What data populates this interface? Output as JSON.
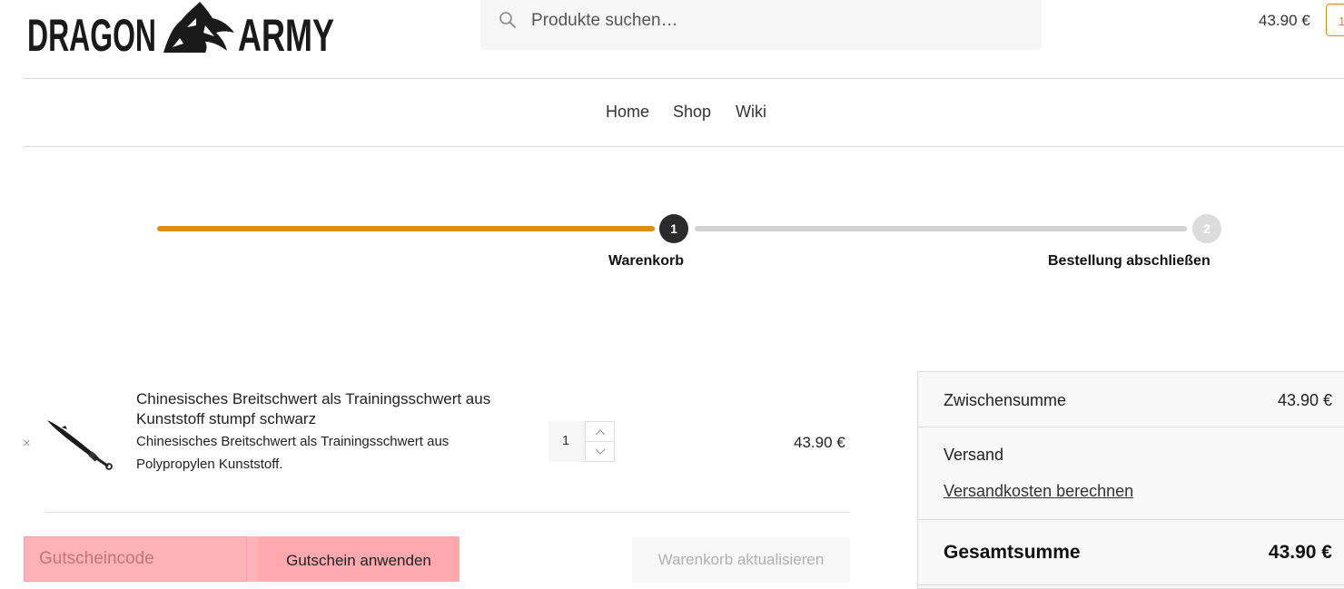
{
  "header": {
    "logo_text": "DRAGON ARMY",
    "search_placeholder": "Produkte suchen…",
    "cart_total": "43.90 €",
    "cart_count": "1"
  },
  "nav": {
    "items": [
      {
        "label": "Home"
      },
      {
        "label": "Shop"
      },
      {
        "label": "Wiki"
      }
    ]
  },
  "steps": {
    "progress": 0.5,
    "items": [
      {
        "number": "1",
        "label": "Warenkorb",
        "state": "active"
      },
      {
        "number": "2",
        "label": "Bestellung abschließen",
        "state": "pending"
      }
    ]
  },
  "cart": {
    "remove_symbol": "×",
    "item": {
      "title": "Chinesisches Breitschwert als Trainingsschwert aus Kunststoff stumpf schwarz",
      "description": "Chinesisches Breitschwert als Trainingsschwert aus Polypropylen Kunststoff.",
      "quantity": "1",
      "price": "43.90 €"
    },
    "coupon_placeholder": "Gutscheincode",
    "apply_coupon_label": "Gutschein anwenden",
    "update_cart_label": "Warenkorb aktualisieren"
  },
  "totals": {
    "subtotal_label": "Zwischensumme",
    "subtotal_value": "43.90 €",
    "shipping_label": "Versand",
    "shipping_link": "Versandkosten berechnen",
    "total_label": "Gesamtsumme",
    "total_value": "43.90 €"
  },
  "colors": {
    "accent": "#d98f10",
    "active_step": "#2b2b2b",
    "inactive_bar": "#d3d3d3",
    "coupon_highlight": "#ffb3b8"
  }
}
